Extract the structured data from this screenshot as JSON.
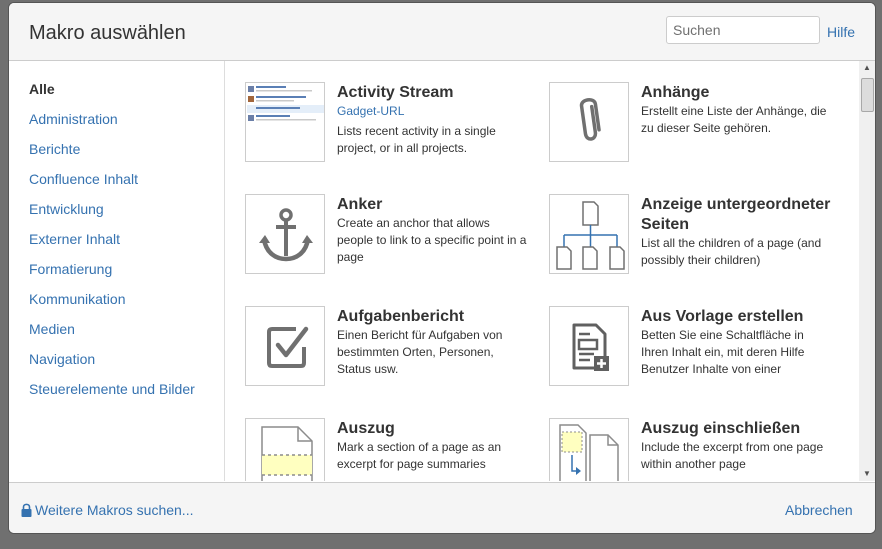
{
  "dialog": {
    "title": "Makro auswählen",
    "search_placeholder": "Suchen",
    "help_label": "Hilfe"
  },
  "sidebar": {
    "items": [
      {
        "label": "Alle",
        "active": true
      },
      {
        "label": "Administration"
      },
      {
        "label": "Berichte"
      },
      {
        "label": "Confluence Inhalt"
      },
      {
        "label": "Entwicklung"
      },
      {
        "label": "Externer Inhalt"
      },
      {
        "label": "Formatierung"
      },
      {
        "label": "Kommunikation"
      },
      {
        "label": "Medien"
      },
      {
        "label": "Navigation"
      },
      {
        "label": "Steuerelemente und Bilder"
      }
    ]
  },
  "macros": [
    {
      "name": "Activity Stream",
      "link": "Gadget-URL",
      "description": "Lists recent activity in a single project, or in all projects.",
      "icon": "activity-stream-thumbnail"
    },
    {
      "name": "Anhänge",
      "description": "Erstellt eine Liste der Anhänge, die zu dieser Seite gehören.",
      "icon": "paperclip-icon"
    },
    {
      "name": "Anker",
      "description": "Create an anchor that allows people to link to a specific point in a page",
      "icon": "anchor-icon"
    },
    {
      "name": "Anzeige untergeordneter Seiten",
      "description": "List all the children of a page (and possibly their children)",
      "icon": "page-tree-icon"
    },
    {
      "name": "Aufgabenbericht",
      "description": "Einen Bericht für Aufgaben von bestimmten Orten, Personen, Status usw.",
      "icon": "checkbox-icon"
    },
    {
      "name": "Aus Vorlage erstellen",
      "description": "Betten Sie eine Schaltfläche in Ihren Inhalt ein, mit deren Hilfe Benutzer Inhalte von einer beliebigen vordefinierten Vorlage",
      "icon": "template-icon"
    },
    {
      "name": "Auszug",
      "description": "Mark a section of a page as an excerpt for page summaries",
      "icon": "excerpt-icon"
    },
    {
      "name": "Auszug einschließen",
      "description": "Include the excerpt from one page within another page",
      "icon": "excerpt-include-icon"
    }
  ],
  "footer": {
    "more_label": "Weitere Makros suchen...",
    "cancel_label": "Abbrechen"
  },
  "colors": {
    "link": "#3572b0",
    "icon_gray": "#707070",
    "excerpt_highlight": "#ffffc0"
  }
}
